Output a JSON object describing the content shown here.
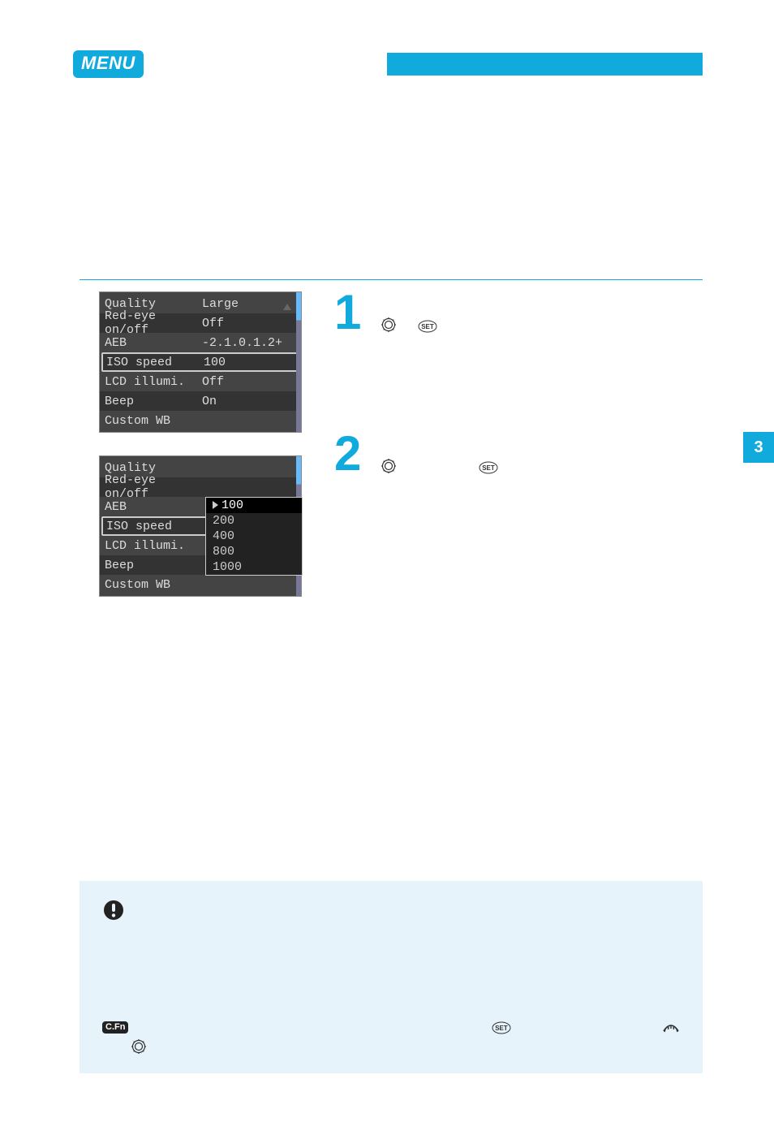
{
  "header": {
    "menu_badge": "MENU"
  },
  "side_tab": "3",
  "screen1": {
    "rows": [
      {
        "key": "Quality",
        "val": "Large",
        "tab_icon": true
      },
      {
        "key": "Red-eye on/off",
        "val": "Off"
      },
      {
        "key": "AEB",
        "val": "-2.1.0.1.2+"
      },
      {
        "key": "ISO speed",
        "val": "100",
        "selected": true
      },
      {
        "key": "LCD illumi.",
        "val": "Off"
      },
      {
        "key": "Beep",
        "val": "On"
      },
      {
        "key": "Custom WB",
        "val": ""
      }
    ]
  },
  "screen2": {
    "rows": [
      {
        "key": "Quality"
      },
      {
        "key": "Red-eye on/off"
      },
      {
        "key": "AEB"
      },
      {
        "key": "ISO speed",
        "selected": true
      },
      {
        "key": "LCD illumi."
      },
      {
        "key": "Beep"
      },
      {
        "key": "Custom WB"
      }
    ],
    "submenu": [
      {
        "label": "100",
        "active": true
      },
      {
        "label": "200"
      },
      {
        "label": "400"
      },
      {
        "label": "800"
      },
      {
        "label": "1000"
      }
    ]
  },
  "steps": {
    "s1": {
      "num": "1"
    },
    "s2": {
      "num": "2"
    }
  },
  "icons": {
    "dial": "quick-control-dial",
    "set": "SET",
    "cmd_dial": "main-dial",
    "cfn": "C.Fn",
    "info": "caution"
  }
}
